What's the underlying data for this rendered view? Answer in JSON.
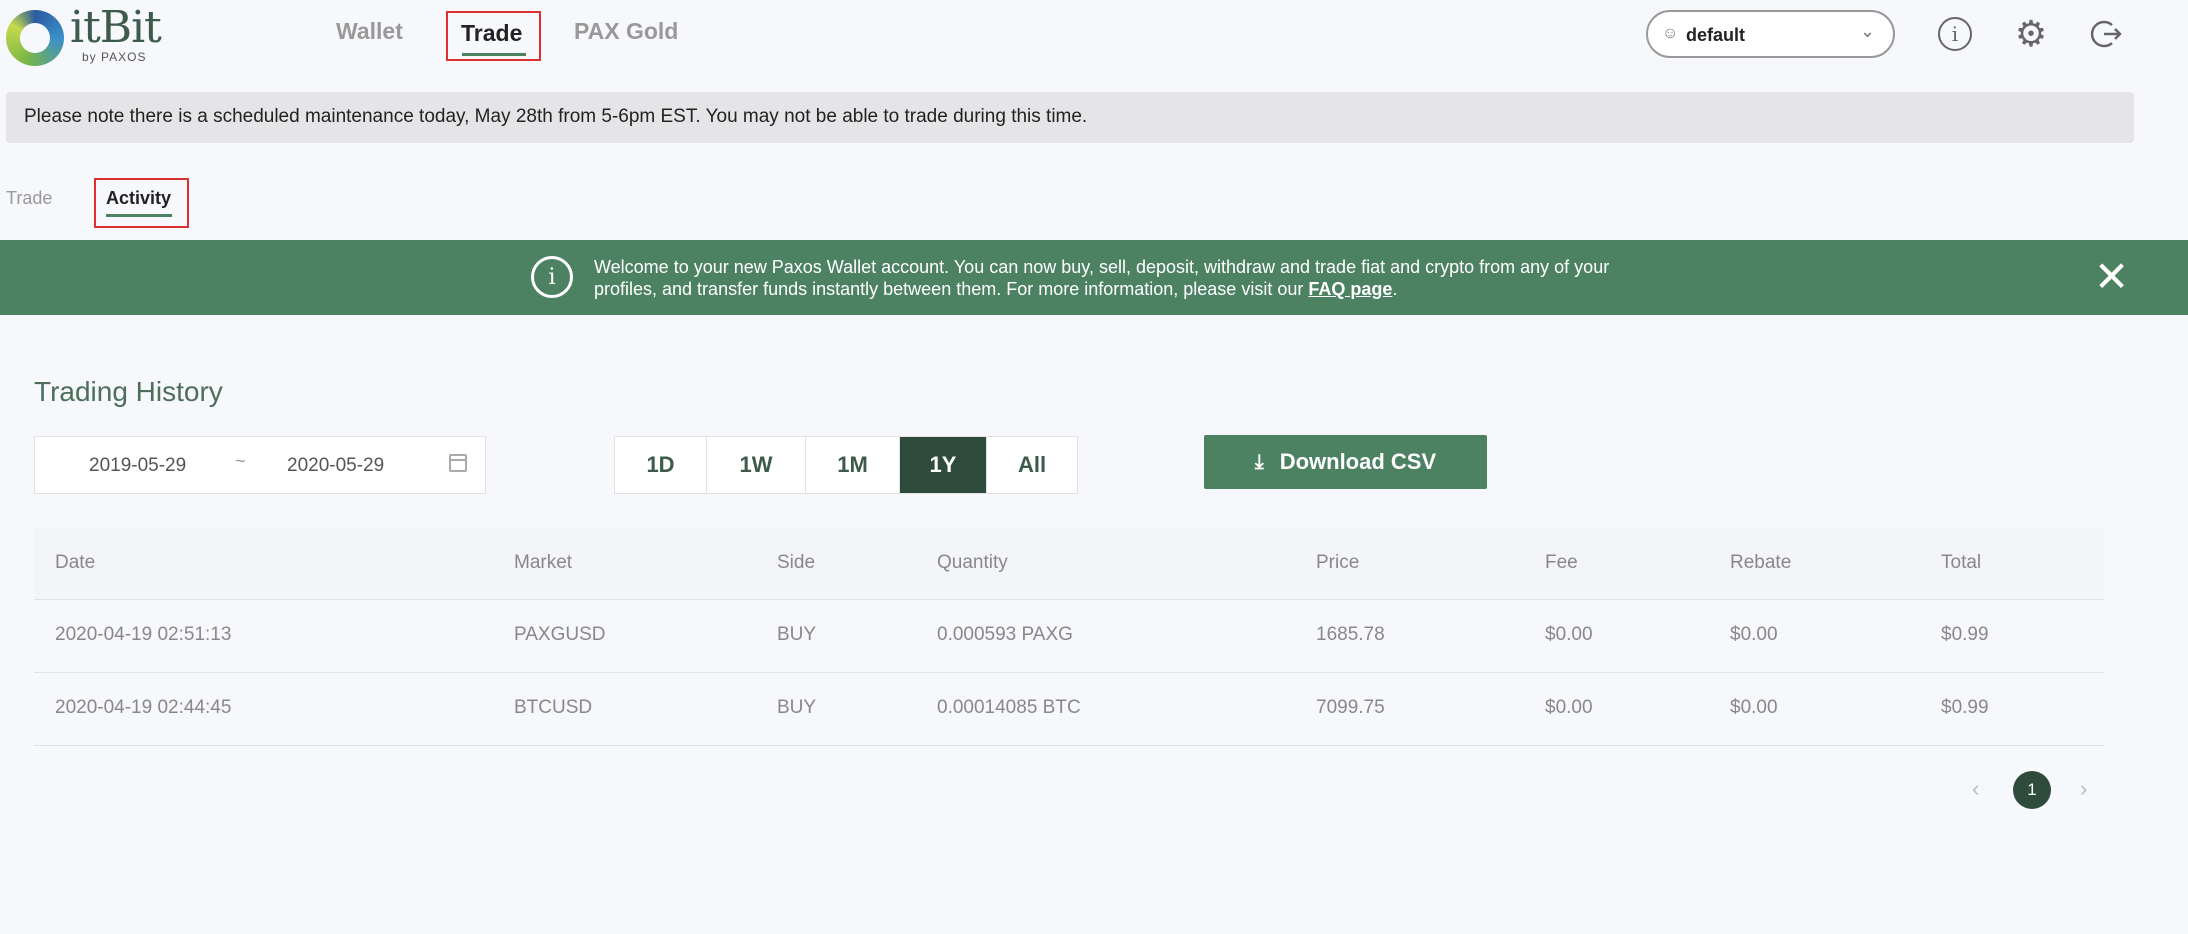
{
  "header": {
    "logo_text": "itBit",
    "logo_sub": "by PAXOS",
    "nav": [
      "Wallet",
      "Trade",
      "PAX Gold"
    ],
    "profile": "default"
  },
  "maintenance": "Please note there is a scheduled maintenance today, May 28th from 5-6pm EST. You may not be able to trade during this time.",
  "subtabs": [
    "Trade",
    "Activity"
  ],
  "welcome": {
    "text_before": "Welcome to your new Paxos Wallet account. You can now buy, sell, deposit, withdraw and trade fiat and crypto from any of your profiles, and transfer funds instantly between them. For more information, please visit our ",
    "link": "FAQ page",
    "text_after": "."
  },
  "history": {
    "title": "Trading History",
    "date_from": "2019-05-29",
    "date_sep": "~",
    "date_to": "2020-05-29",
    "periods": [
      "1D",
      "1W",
      "1M",
      "1Y",
      "All"
    ],
    "active_period": "1Y",
    "download_label": "Download CSV",
    "columns": [
      "Date",
      "Market",
      "Side",
      "Quantity",
      "Price",
      "Fee",
      "Rebate",
      "Total"
    ],
    "rows": [
      [
        "2020-04-19 02:51:13",
        "PAXGUSD",
        "BUY",
        "0.000593 PAXG",
        "1685.78",
        "$0.00",
        "$0.00",
        "$0.99"
      ],
      [
        "2020-04-19 02:44:45",
        "BTCUSD",
        "BUY",
        "0.00014085 BTC",
        "7099.75",
        "$0.00",
        "$0.00",
        "$0.99"
      ]
    ],
    "page": "1"
  },
  "colors": {
    "brand_green": "#4c8262",
    "dark_green": "#2f4b3b",
    "highlight_red": "#d93030"
  }
}
